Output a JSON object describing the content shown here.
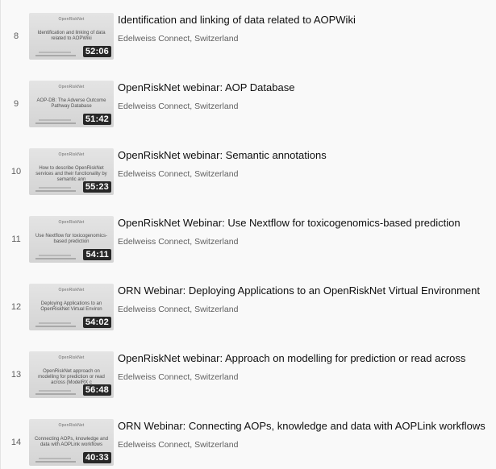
{
  "playlist": {
    "items": [
      {
        "index": "8",
        "title": "Identification and linking of data related to AOPWiki",
        "channel": "Edelweiss Connect, Switzerland",
        "duration": "52:06",
        "thumb_brand": "OpenRiskNet",
        "thumb_text": "Identification and linking of data related to AOPWiki"
      },
      {
        "index": "9",
        "title": "OpenRiskNet webinar: AOP Database",
        "channel": "Edelweiss Connect, Switzerland",
        "duration": "51:42",
        "thumb_brand": "OpenRiskNet",
        "thumb_text": "AOP-DB: The Adverse Outcome Pathway Database"
      },
      {
        "index": "10",
        "title": "OpenRiskNet webinar: Semantic annotations",
        "channel": "Edelweiss Connect, Switzerland",
        "duration": "55:23",
        "thumb_brand": "OpenRiskNet",
        "thumb_text": "How to describe OpenRiskNet services and their functionality by semantic ann"
      },
      {
        "index": "11",
        "title": "OpenRiskNet Webinar: Use Nextflow for toxicogenomics-based prediction",
        "channel": "Edelweiss Connect, Switzerland",
        "duration": "54:11",
        "thumb_brand": "OpenRiskNet",
        "thumb_text": "Use Nextflow for toxicogenomics-based prediction"
      },
      {
        "index": "12",
        "title": "ORN Webinar: Deploying Applications to an OpenRiskNet Virtual Environment",
        "channel": "Edelweiss Connect, Switzerland",
        "duration": "54:02",
        "thumb_brand": "OpenRiskNet",
        "thumb_text": "Deploying Applications to an OpenRiskNet Virtual Environ"
      },
      {
        "index": "13",
        "title": "OpenRiskNet webinar: Approach on modelling for prediction or read across",
        "channel": "Edelweiss Connect, Switzerland",
        "duration": "56:48",
        "thumb_brand": "OpenRiskNet",
        "thumb_text": "OpenRiskNet approach on modelling for prediction or read across (ModelRX c"
      },
      {
        "index": "14",
        "title": "ORN Webinar: Connecting AOPs, knowledge and data with AOPLink workflows",
        "channel": "Edelweiss Connect, Switzerland",
        "duration": "40:33",
        "thumb_brand": "OpenRiskNet",
        "thumb_text": "Connecting AOPs, knowledge and data with AOPLink workflows"
      }
    ]
  }
}
